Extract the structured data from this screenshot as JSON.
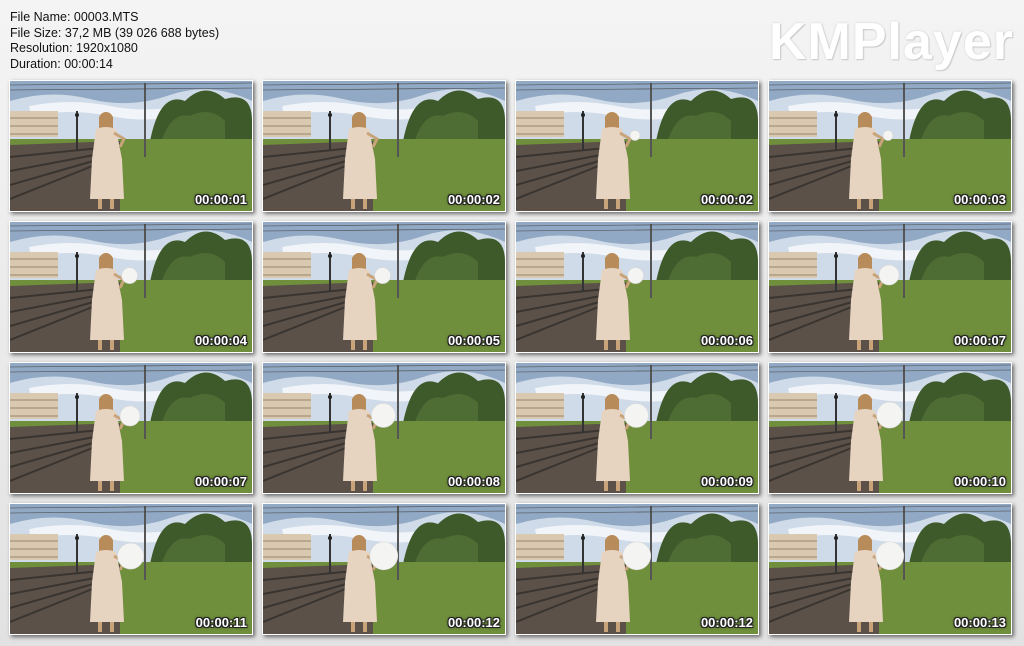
{
  "info": {
    "file_name": "File Name: 00003.MTS",
    "file_size": "File Size: 37,2 MB (39 026 688 bytes)",
    "resolution": "Resolution: 1920x1080",
    "duration": "Duration: 00:00:14"
  },
  "brand": "KMPlayer",
  "colors": {
    "sky": "#cfdbe8",
    "grass": "#6f8f3c",
    "trees": "#3e5a2a",
    "dress": "#e6d3c0",
    "timestamp": "#ffffff"
  },
  "thumbnails": [
    {
      "time": "00:00:01",
      "balloon": 0
    },
    {
      "time": "00:00:02",
      "balloon": 0
    },
    {
      "time": "00:00:02",
      "balloon": 1
    },
    {
      "time": "00:00:03",
      "balloon": 1
    },
    {
      "time": "00:00:04",
      "balloon": 2
    },
    {
      "time": "00:00:05",
      "balloon": 2
    },
    {
      "time": "00:00:06",
      "balloon": 2
    },
    {
      "time": "00:00:07",
      "balloon": 3
    },
    {
      "time": "00:00:07",
      "balloon": 3
    },
    {
      "time": "00:00:08",
      "balloon": 4
    },
    {
      "time": "00:00:09",
      "balloon": 4
    },
    {
      "time": "00:00:10",
      "balloon": 5
    },
    {
      "time": "00:00:11",
      "balloon": 5
    },
    {
      "time": "00:00:12",
      "balloon": 6
    },
    {
      "time": "00:00:12",
      "balloon": 6
    },
    {
      "time": "00:00:13",
      "balloon": 6
    }
  ]
}
